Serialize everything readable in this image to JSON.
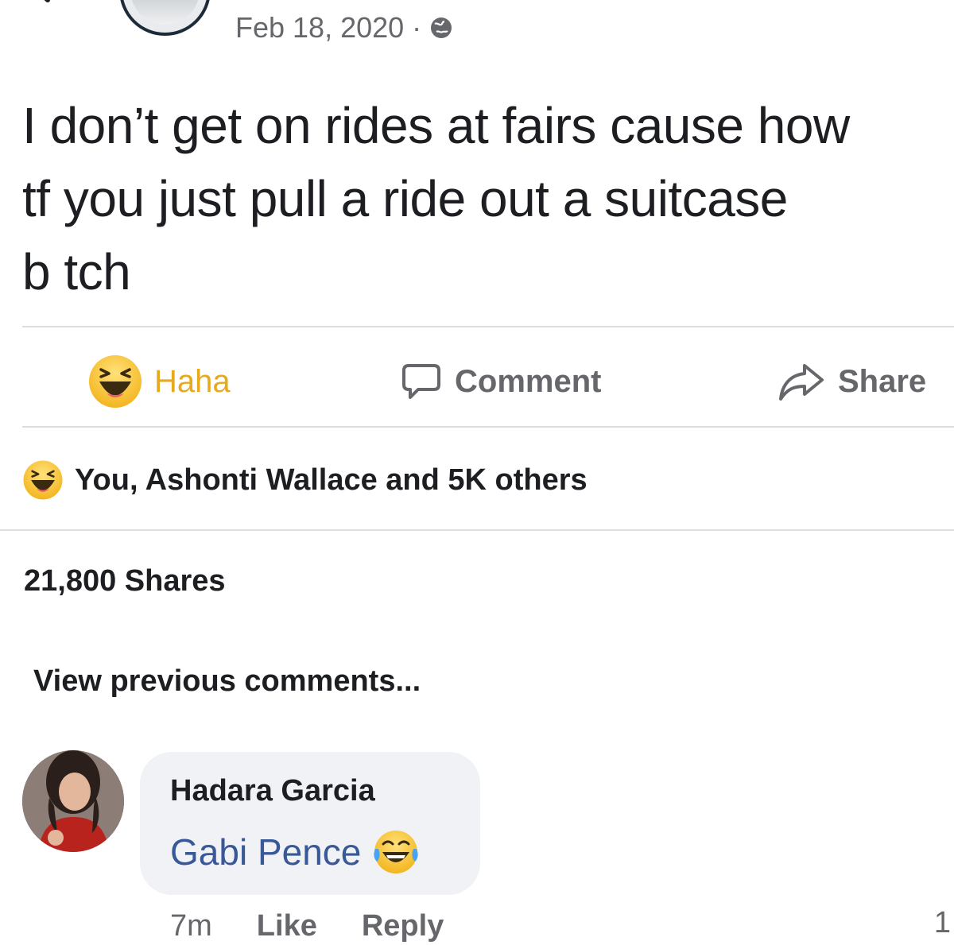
{
  "post": {
    "date": "Feb 18, 2020 ·",
    "privacy_icon": "globe-icon",
    "text": "I don’t get on rides at fairs cause how\ntf you just pull a ride out a suitcase\nb tch"
  },
  "actions": {
    "haha_label": "Haha",
    "comment_label": "Comment",
    "share_label": "Share"
  },
  "reactions": {
    "summary": "You, Ashonti Wallace and 5K others"
  },
  "shares": {
    "count_text": "21,800 Shares"
  },
  "comments": {
    "view_previous": "View previous comments...",
    "items": [
      {
        "author": "Hadara Garcia",
        "mention": "Gabi Pence",
        "time": "7m",
        "like_label": "Like",
        "reply_label": "Reply"
      }
    ],
    "trailing_count": "1"
  },
  "colors": {
    "haha_accent": "#e7a91e",
    "mention_link": "#385898",
    "muted_text": "#65676b",
    "bubble_bg": "#f0f2f5"
  }
}
